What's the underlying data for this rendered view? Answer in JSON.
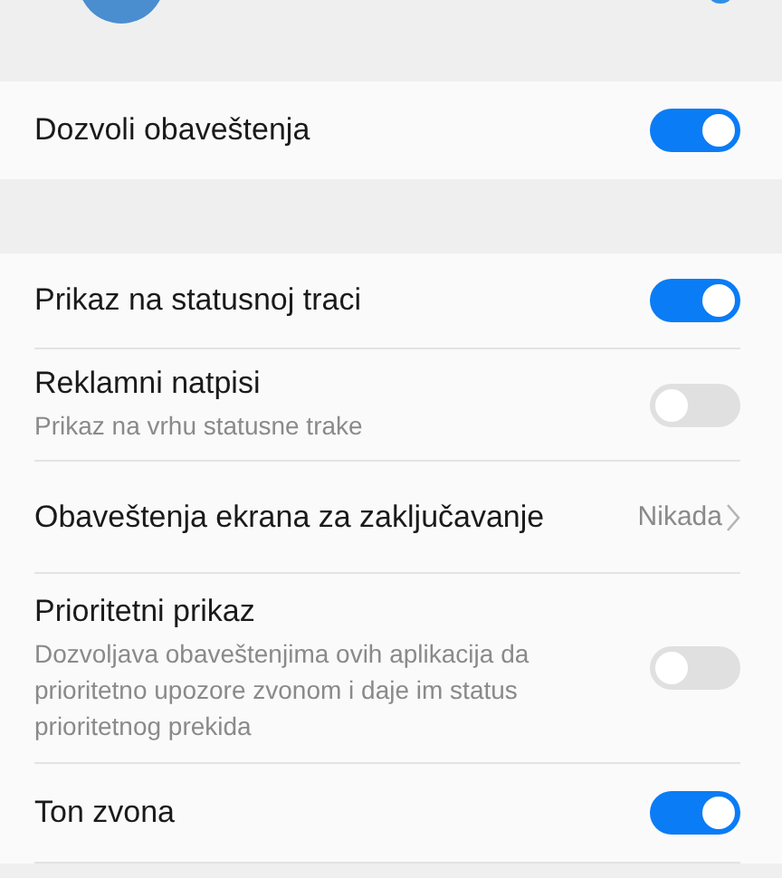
{
  "main_switch": {
    "label": "Dozvoli obaveštenja",
    "on": true
  },
  "settings": [
    {
      "kind": "toggle",
      "label": "Prikaz na statusnoj traci",
      "on": true
    },
    {
      "kind": "toggle",
      "label": "Reklamni natpisi",
      "description": "Prikaz na vrhu statusne trake",
      "on": false
    },
    {
      "kind": "link",
      "label": "Obaveštenja ekrana za zaključavanje",
      "value": "Nikada"
    },
    {
      "kind": "toggle",
      "label": "Prioritetni prikaz",
      "description": "Dozvoljava obaveštenjima ovih aplikacija da prioritetno upozore zvonom i daje im status prioritetnog prekida",
      "on": false
    },
    {
      "kind": "toggle",
      "label": "Ton zvona",
      "on": true
    }
  ]
}
